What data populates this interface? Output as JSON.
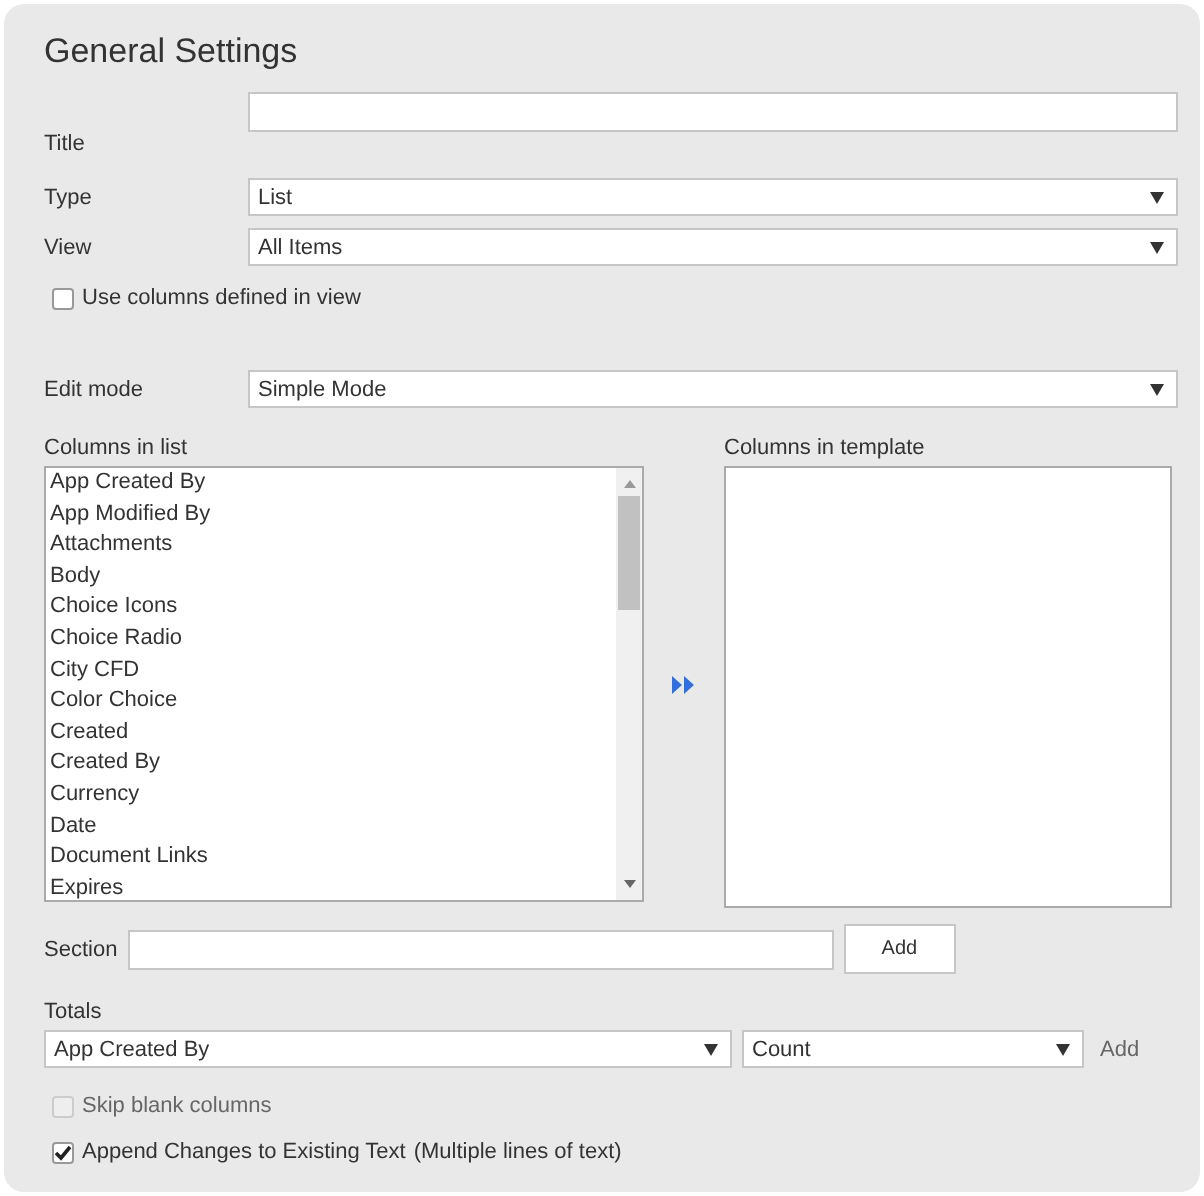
{
  "heading": "General Settings",
  "title_field": {
    "label": "Title"
  },
  "type_select": {
    "label": "Type",
    "value": "List"
  },
  "view_select": {
    "label": "View",
    "value": "All Items"
  },
  "use_view_columns": {
    "label": "Use columns defined in view",
    "checked": false,
    "disabled": false
  },
  "edit_mode_select": {
    "label": "Edit mode",
    "value": "Simple Mode"
  },
  "columns_in_list": {
    "label": "Columns in list",
    "items": [
      {
        "label": "App Created By",
        "selected": false
      },
      {
        "label": "App Modified By",
        "selected": false
      },
      {
        "label": "Attachments",
        "selected": false
      },
      {
        "label": "Body",
        "selected": false
      },
      {
        "label": "Choice Icons",
        "selected": false
      },
      {
        "label": "Choice Radio",
        "selected": false
      },
      {
        "label": "City CFD",
        "selected": false
      },
      {
        "label": "Color Choice",
        "selected": false
      },
      {
        "label": "Created",
        "selected": false
      },
      {
        "label": "Created By",
        "selected": false
      },
      {
        "label": "Currency",
        "selected": false
      },
      {
        "label": "Date",
        "selected": false
      },
      {
        "label": "Document Links",
        "selected": false
      },
      {
        "label": "Expires",
        "selected": false
      }
    ]
  },
  "columns_in_template": {
    "label": "Columns in template"
  },
  "section": {
    "label": "Section",
    "button": "Add"
  },
  "totals": {
    "label": "Totals",
    "column_value": "App Created By",
    "function_value": "Count",
    "add_link": "Add"
  },
  "options": [
    {
      "label": "Skip blank columns",
      "checked": false,
      "disabled": true
    },
    {
      "label": "Append Changes to Existing Text",
      "note": "(Multiple lines of text)",
      "checked": true,
      "disabled": false
    }
  ]
}
